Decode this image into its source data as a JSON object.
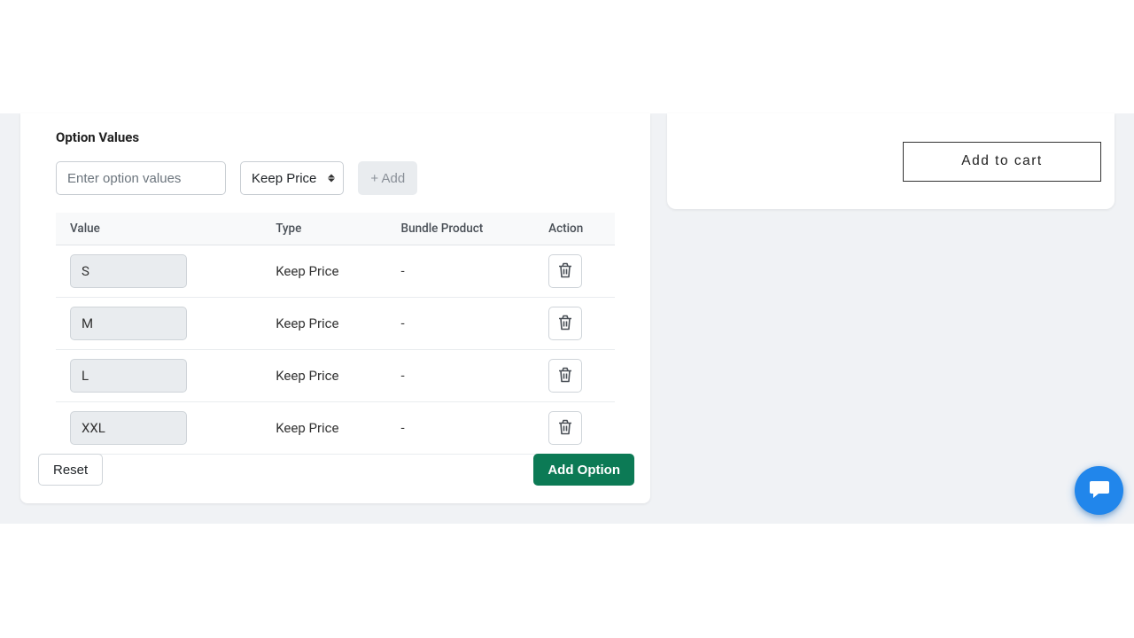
{
  "optionValues": {
    "title": "Option Values",
    "input_placeholder": "Enter option values",
    "price_select_label": "Keep Price",
    "add_button_label": "+ Add",
    "columns": {
      "value": "Value",
      "type": "Type",
      "bundle": "Bundle Product",
      "action": "Action"
    },
    "rows": [
      {
        "value": "S",
        "type": "Keep Price",
        "bundle": "-"
      },
      {
        "value": "M",
        "type": "Keep Price",
        "bundle": "-"
      },
      {
        "value": "L",
        "type": "Keep Price",
        "bundle": "-"
      },
      {
        "value": "XXL",
        "type": "Keep Price",
        "bundle": "-"
      }
    ],
    "reset_label": "Reset",
    "add_option_label": "Add Option"
  },
  "cart": {
    "add_to_cart_label": "Add to cart"
  }
}
